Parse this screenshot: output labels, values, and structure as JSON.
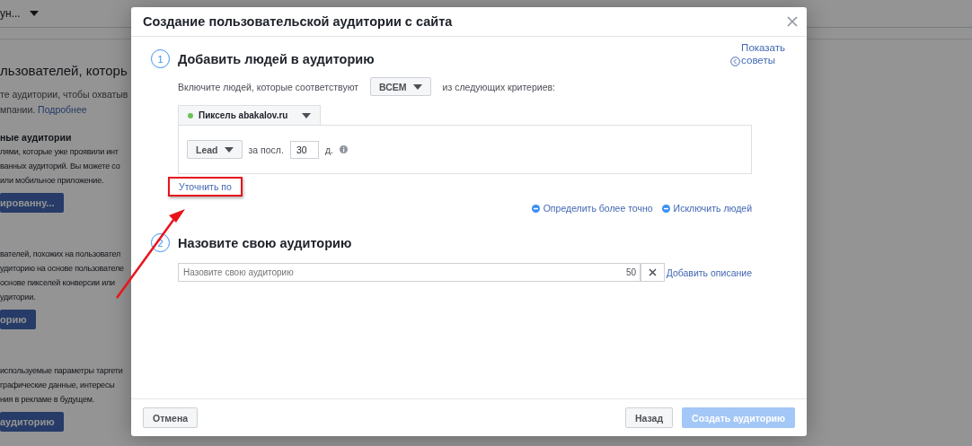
{
  "background": {
    "top_selector": "ун...",
    "heading": "льзователей, которь",
    "intro": {
      "text": "те аудитории, чтобы охватыв",
      "text_2": "мпании.",
      "link": "Подробнее"
    },
    "sections": [
      {
        "title": "ные аудитории",
        "lines": [
          "лями, которые уже проявили инт",
          "ванных аудиторий. Вы можете со",
          "или мобильное приложение."
        ],
        "button": "ированну..."
      },
      {
        "lines": [
          "вателей, похожих на пользовател",
          "удиторию на основе пользователе",
          "основе пикселей конверсии или",
          "удитории."
        ],
        "button": "орию"
      },
      {
        "lines": [
          "используемые параметры таргети",
          "графические данные, интересы",
          "ния в рекламе в будущем."
        ],
        "button": "аудиторию"
      }
    ]
  },
  "dialog": {
    "title": "Создание пользовательской аудитории с сайта",
    "tips_link": [
      "Показать",
      "советы"
    ],
    "step_1": {
      "number": "1",
      "title": "Добавить людей в аудиторию",
      "include_prefix": "Включите людей, которые соответствуют",
      "match_dropdown": "ВСЕМ",
      "include_suffix": "из следующих критериев:",
      "source_tab": "Пиксель abakalov.ru",
      "event_dropdown": "Lead",
      "period_label": "за посл.",
      "days_value": "30",
      "days_unit": "д.",
      "refine_link": "Уточнить по",
      "refine_highlighted": true,
      "actions": [
        "Определить более точно",
        "Исключить людей"
      ]
    },
    "step_2": {
      "number": "2",
      "title": "Назовите свою аудиторию",
      "name_field": {
        "placeholder": "Назовите свою аудиторию"
      },
      "counter": "50",
      "description_link": "Добавить описание"
    },
    "footer": {
      "cancel": "Отмена",
      "back": "Назад",
      "create": {
        "label": "Создать аудиторию",
        "disabled": true
      }
    }
  }
}
